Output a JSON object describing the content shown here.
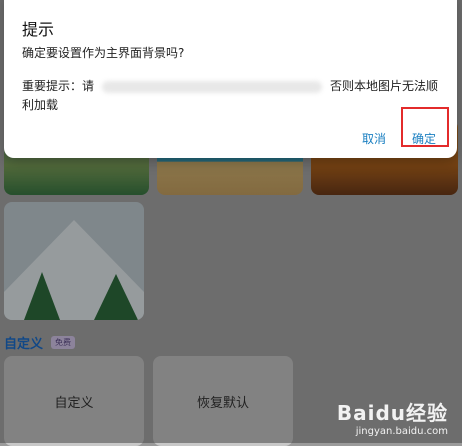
{
  "dialog": {
    "title": "提示",
    "question": "确定要设置作为主界面背景吗?",
    "note_prefix": "重要提示：请",
    "note_suffix": "否则本地图片无法顺利加载",
    "cancel_label": "取消",
    "confirm_label": "确定"
  },
  "section": {
    "title": "自定义",
    "badge": "免费"
  },
  "cards": {
    "custom_label": "自定义",
    "restore_label": "恢复默认"
  },
  "watermark": {
    "logo": "Baidu经验",
    "url": "jingyan.baidu.com"
  },
  "colors": {
    "accent": "#1a7fc1",
    "highlight": "#e32b2b"
  }
}
